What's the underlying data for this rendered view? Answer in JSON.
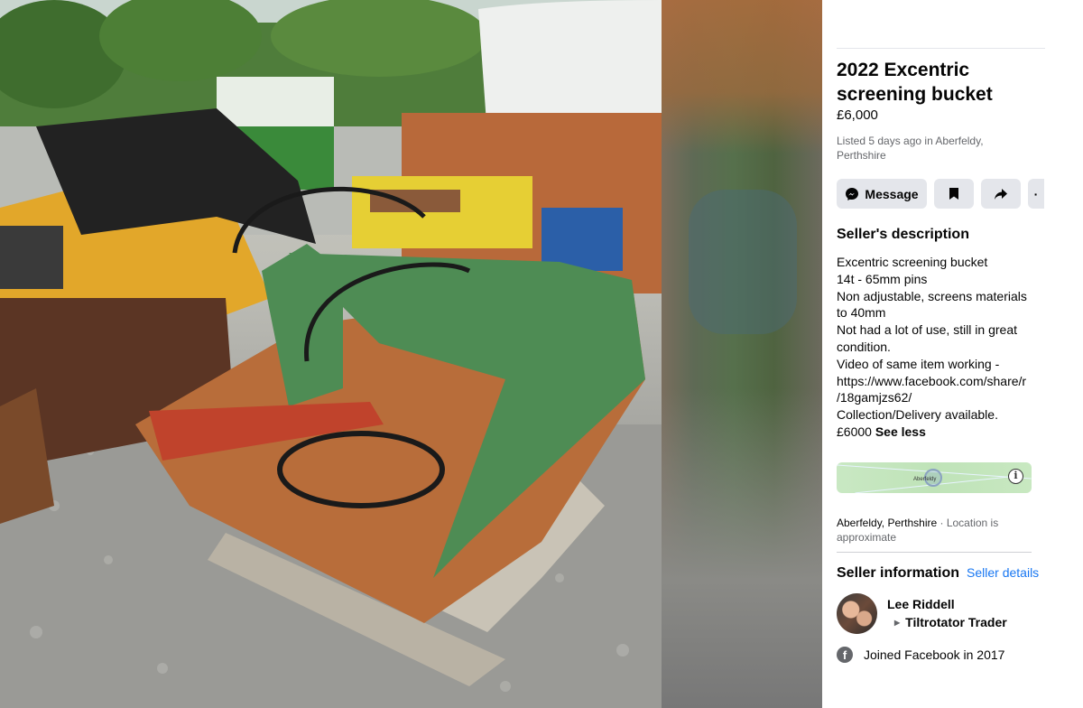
{
  "listing": {
    "title_line1": "2022 Excentric",
    "title_line2": "screening bucket",
    "price": "£6,000",
    "listed_line1": "Listed 5 days ago in Aberfeldy,",
    "listed_line2": "Perthshire"
  },
  "actions": {
    "message_label": "Message",
    "message_icon": "messenger-icon",
    "save_icon": "bookmark-icon",
    "share_icon": "share-arrow-icon",
    "more_icon": "more-icon"
  },
  "description": {
    "heading": "Seller's description",
    "lines": [
      "Excentric screening bucket",
      "14t - 65mm pins",
      "Non adjustable, screens materials",
      "to 40mm",
      "Not had a lot of use, still in great",
      "condition.",
      "Video of same item working -",
      "https://www.facebook.com/share/r",
      "/18gamjzs62/",
      "Collection/Delivery available."
    ],
    "last_line": "£6000",
    "see_less": "See less"
  },
  "map": {
    "label": "Aberfeldy",
    "info_icon": "info-icon"
  },
  "location": {
    "place": "Aberfeldy, Perthshire",
    "note_part1": " · Location is",
    "note_part2": "approximate"
  },
  "seller": {
    "heading": "Seller information",
    "details_link": "Seller details",
    "name": "Lee Riddell",
    "subtitle": "Tiltrotator Trader",
    "joined": "Joined Facebook in 2017"
  },
  "colors": {
    "link": "#1877f2",
    "button_bg": "#e4e6eb",
    "secondary_text": "#65676b"
  }
}
